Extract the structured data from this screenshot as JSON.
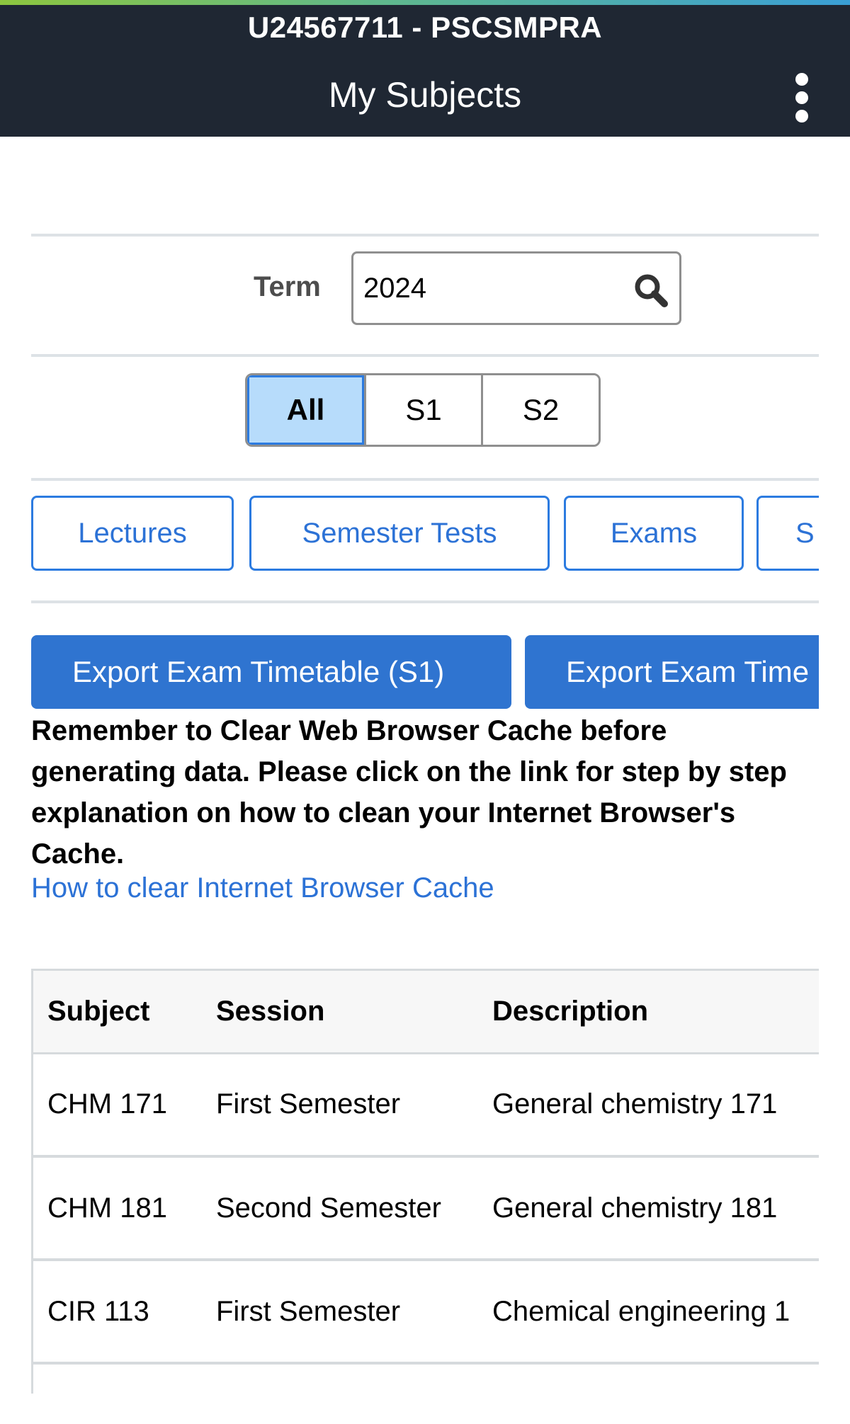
{
  "header": {
    "user_id": "U24567711 - PSCSMPRA",
    "title": "My Subjects",
    "menu_icon": "kebab-menu-icon"
  },
  "term": {
    "label": "Term",
    "value": "2024",
    "search_icon": "search-icon"
  },
  "semester_filter": {
    "options": [
      "All",
      "S1",
      "S2"
    ],
    "selected": "All"
  },
  "tabs": [
    "Lectures",
    "Semester Tests",
    "Exams",
    "S"
  ],
  "export_buttons": [
    "Export Exam Timetable (S1)",
    "Export Exam Time"
  ],
  "notice": "Remember to Clear Web Browser Cache before generating data. Please click on the link for step by step explanation on how to clean your Internet Browser's Cache.",
  "help_link": "How to clear Internet Browser Cache",
  "table": {
    "columns": [
      "Subject",
      "Session",
      "Description"
    ],
    "rows": [
      [
        "CHM 171",
        "First Semester",
        "General chemistry 171"
      ],
      [
        "CHM 181",
        "Second Semester",
        "General chemistry 181"
      ],
      [
        "CIR 113",
        "First Semester",
        "Chemical engineering 1"
      ]
    ]
  },
  "colors": {
    "header_bg": "#1f2733",
    "primary": "#2f74d0",
    "link": "#2c72d6",
    "selected_segment": "#b7dcfb"
  }
}
